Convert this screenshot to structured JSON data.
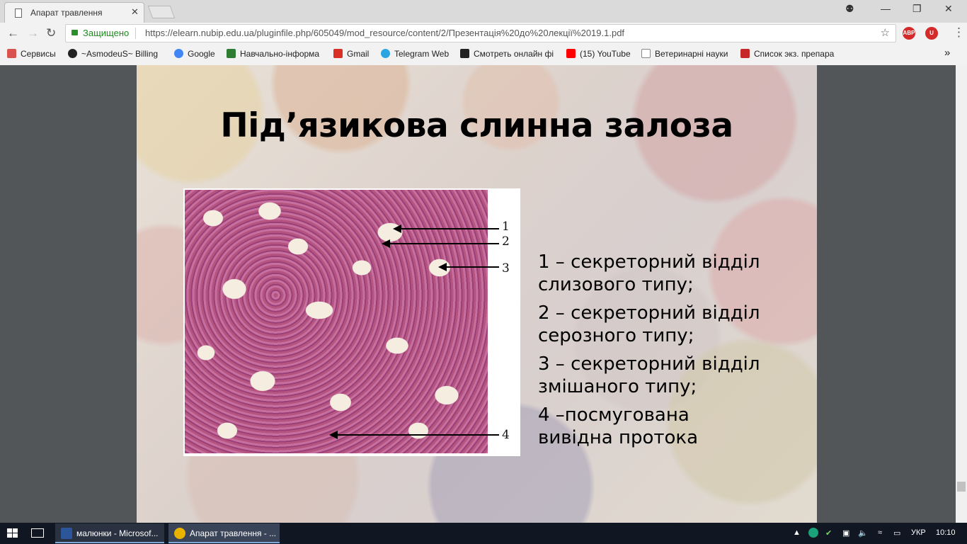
{
  "browser": {
    "tab_title": "Апарат травлення",
    "tab_close": "✕",
    "window_controls": [
      "⚉",
      "—",
      "❐",
      "✕"
    ],
    "secure_label": "Защищено",
    "url": "https://elearn.nubip.edu.ua/pluginfile.php/605049/mod_resource/content/2/Презентація%20до%20лекції%2019.1.pdf",
    "extensions": [
      "ABP",
      "U"
    ]
  },
  "bookmarks": [
    {
      "label": "Сервисы",
      "icon": "apps-grid-icon",
      "color": "#d9534f"
    },
    {
      "label": "~AsmodeuS~ Billing",
      "icon": "c-logo-icon",
      "color": "#222222"
    },
    {
      "label": "Google",
      "icon": "google-icon",
      "color": "#4285f4"
    },
    {
      "label": "Навчально-інформа",
      "icon": "shield-icon",
      "color": "#2e7d32"
    },
    {
      "label": "Gmail",
      "icon": "gmail-icon",
      "color": "#d93025"
    },
    {
      "label": "Telegram Web",
      "icon": "telegram-icon",
      "color": "#2ca5e0"
    },
    {
      "label": "Смотреть онлайн фі",
      "icon": "hd-icon",
      "color": "#222222"
    },
    {
      "label": "(15) YouTube",
      "icon": "youtube-icon",
      "color": "#ff0000"
    },
    {
      "label": "Ветеринарні науки",
      "icon": "page-icon",
      "color": "#888888"
    },
    {
      "label": "Список экз. препара",
      "icon": "bookmark-icon",
      "color": "#c62828"
    }
  ],
  "bookmarks_more": "»",
  "slide": {
    "title": "Під’язикова слинна залоза",
    "figure_labels": [
      "1",
      "2",
      "3",
      "4"
    ],
    "legend": [
      {
        "line1": " 1 – секреторний відділ",
        "line2": "слизового типу;"
      },
      {
        "line1": "2 – секреторний відділ",
        "line2": "серозного типу;"
      },
      {
        "line1": "3 – секреторний відділ",
        "line2": "змішаного типу;"
      },
      {
        "line1": "4 –посмугована",
        "line2": "вивідна протока"
      }
    ]
  },
  "taskbar": {
    "apps": [
      {
        "label": "малюнки - Microsof...",
        "icon": "word-icon",
        "color": "#2b579a"
      },
      {
        "label": "Апарат травлення - ...",
        "icon": "chrome-icon",
        "color": "#e8b400"
      }
    ],
    "language": "УКР",
    "time": "10:10"
  }
}
